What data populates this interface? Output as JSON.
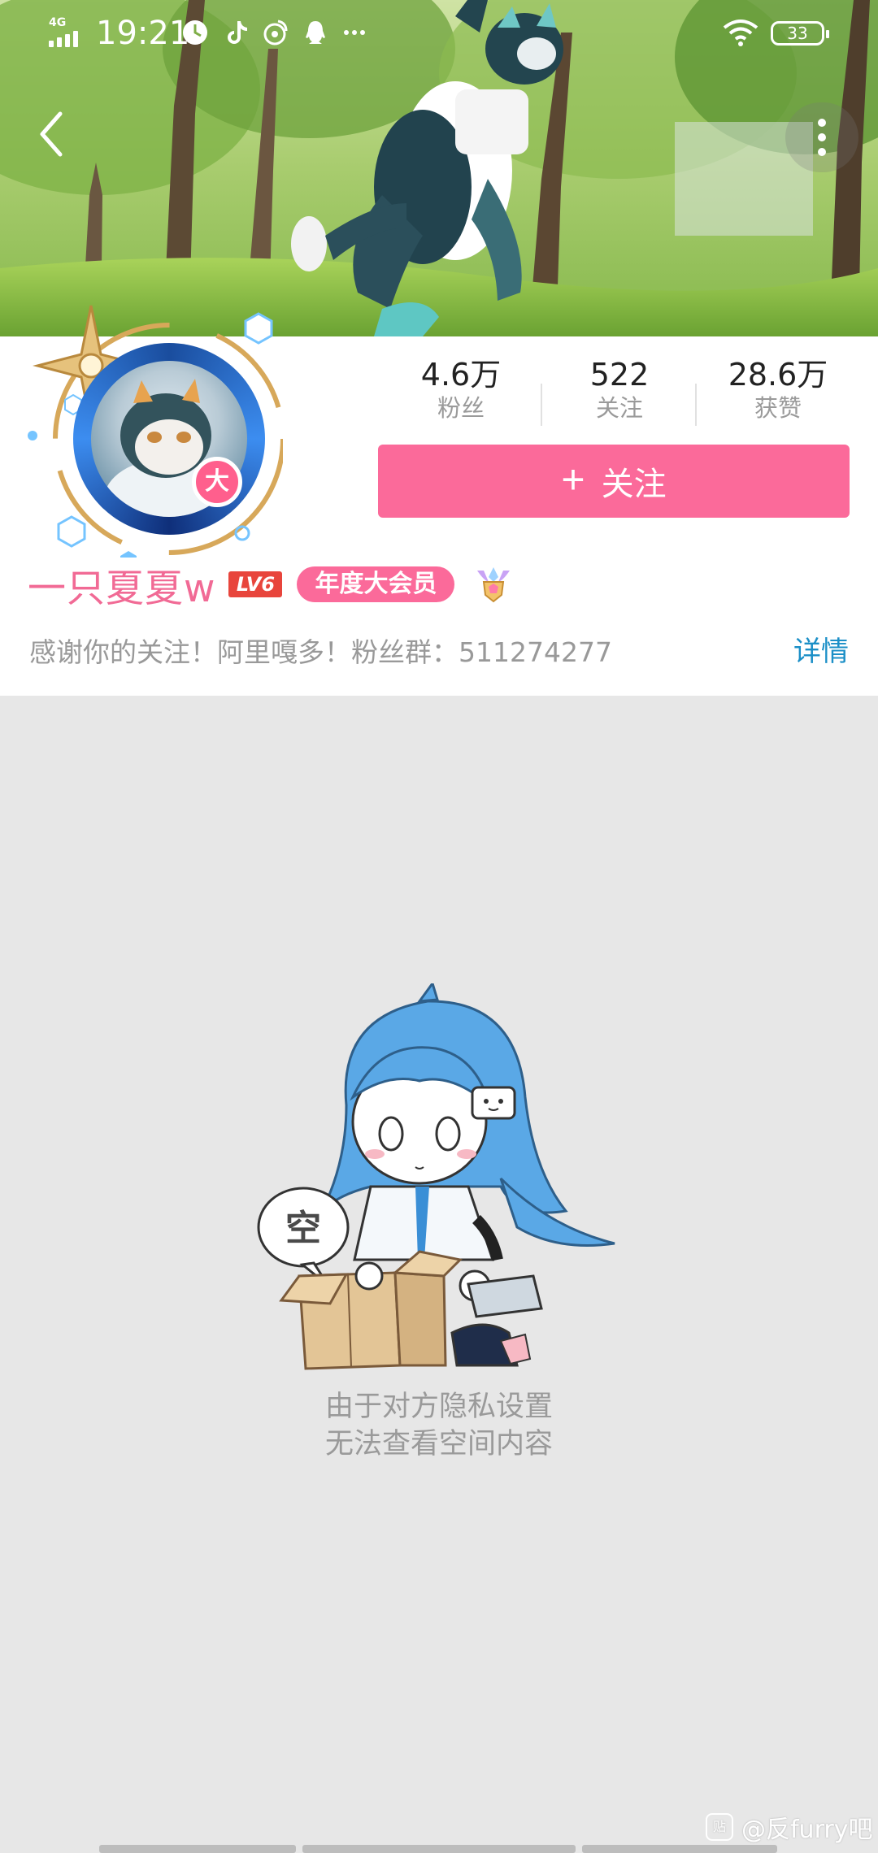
{
  "status_bar": {
    "network": "4G",
    "time": "19:21",
    "battery": "33",
    "icons": [
      "signal-icon",
      "clock-app-icon",
      "tiktok-icon",
      "weibo-icon",
      "qq-icon",
      "more-dots-icon",
      "wifi-icon",
      "battery-icon"
    ]
  },
  "header": {
    "back_icon": "chevron-left-icon",
    "more_icon": "vertical-dots-icon",
    "banner_image": "cover photo of a fursuit character posing in a park"
  },
  "profile": {
    "avatar_badge": "大",
    "stats": [
      {
        "value": "4.6万",
        "label": "粉丝"
      },
      {
        "value": "522",
        "label": "关注"
      },
      {
        "value": "28.6万",
        "label": "获赞"
      }
    ],
    "follow_button": {
      "icon": "+",
      "label": "关注"
    },
    "username": "一只夏夏w",
    "level": "LV6",
    "vip_badge": "年度大会员",
    "signature": "感谢你的关注！阿里嘎多！粉丝群：511274277",
    "detail_link": "详情"
  },
  "empty_state": {
    "bubble_text": "空",
    "message_line1": "由于对方隐私设置",
    "message_line2": "无法查看空间内容"
  },
  "watermark": {
    "text": "@反furry吧",
    "icon_text": "贴"
  },
  "colors": {
    "accent_pink": "#fb6a9a",
    "username_pink": "#f16a95",
    "link_blue": "#1b8fc7",
    "level_red": "#e8453c",
    "page_gray": "#e7e7e7"
  }
}
